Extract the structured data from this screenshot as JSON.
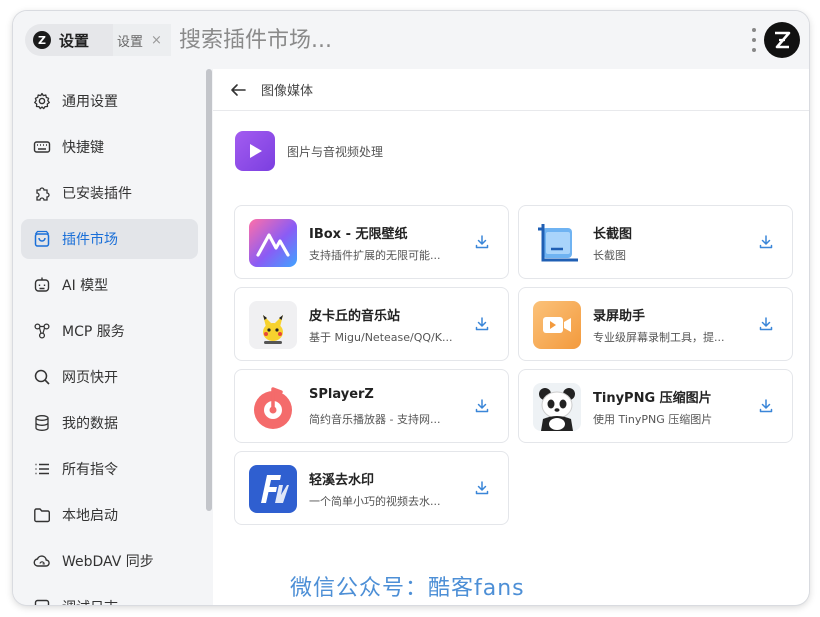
{
  "header": {
    "app_chip_label": "设置",
    "tab_label": "设置",
    "tab_close": "×",
    "search_placeholder": "搜索插件市场..."
  },
  "sidebar": {
    "items": [
      {
        "label": "通用设置",
        "icon": "gear-icon"
      },
      {
        "label": "快捷键",
        "icon": "keyboard-icon"
      },
      {
        "label": "已安装插件",
        "icon": "puzzle-icon"
      },
      {
        "label": "插件市场",
        "icon": "shopping-bag-icon",
        "active": true
      },
      {
        "label": "AI 模型",
        "icon": "robot-icon"
      },
      {
        "label": "MCP 服务",
        "icon": "network-icon"
      },
      {
        "label": "网页快开",
        "icon": "search-icon"
      },
      {
        "label": "我的数据",
        "icon": "database-icon"
      },
      {
        "label": "所有指令",
        "icon": "list-icon"
      },
      {
        "label": "本地启动",
        "icon": "folder-icon"
      },
      {
        "label": "WebDAV 同步",
        "icon": "cloud-sync-icon"
      },
      {
        "label": "调试日志",
        "icon": "log-icon"
      }
    ]
  },
  "main": {
    "breadcrumb_title": "图像媒体",
    "category_desc": "图片与音视频处理",
    "plugins": [
      {
        "name": "IBox - 无限壁纸",
        "desc": "支持插件扩展的无限可能..."
      },
      {
        "name": "长截图",
        "desc": "长截图"
      },
      {
        "name": "皮卡丘的音乐站",
        "desc": "基于 Migu/Netease/QQ/K..."
      },
      {
        "name": "录屏助手",
        "desc": "专业级屏幕录制工具，提..."
      },
      {
        "name": "SPlayerZ",
        "desc": "简约音乐播放器 - 支持网..."
      },
      {
        "name": "TinyPNG 压缩图片",
        "desc": "使用 TinyPNG 压缩图片"
      },
      {
        "name": "轻溪去水印",
        "desc": "一个简单小巧的视频去水..."
      }
    ]
  },
  "watermark": "微信公众号：酷客fans",
  "colors": {
    "accent": "#1a6fd8",
    "active_bg": "#e3e5e9",
    "download_icon": "#3a86d8"
  }
}
